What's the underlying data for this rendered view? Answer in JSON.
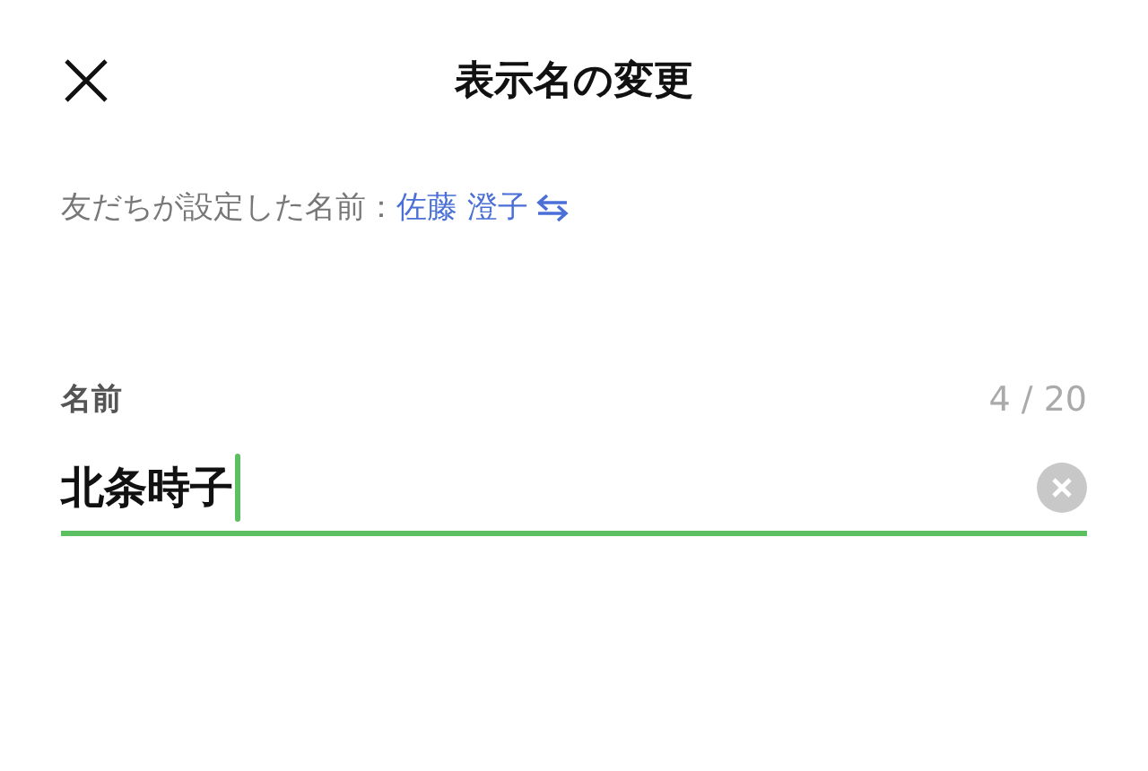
{
  "header": {
    "title": "表示名の変更"
  },
  "friend_name": {
    "label": "友だちが設定した名前：",
    "name": "佐藤 澄子"
  },
  "name_field": {
    "label": "名前",
    "counter": "4 / 20",
    "value": "北条時子",
    "focused": true
  }
}
